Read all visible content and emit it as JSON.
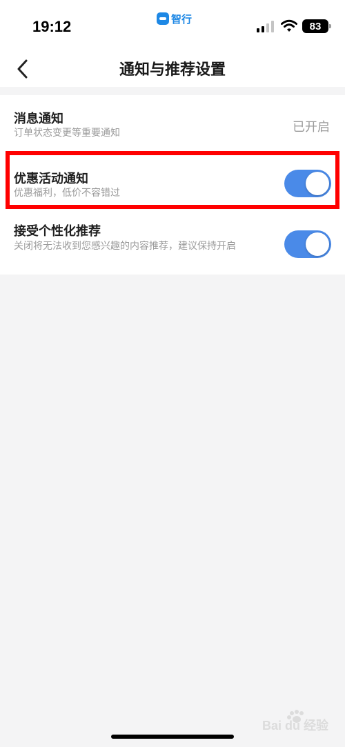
{
  "status_bar": {
    "time": "19:12",
    "app_badge": "智行",
    "battery": "83",
    "signal_bars": 4,
    "signal_bars_active": 2
  },
  "nav": {
    "back_icon": "chevron-left-icon",
    "title": "通知与推荐设置"
  },
  "settings": [
    {
      "title": "消息通知",
      "desc": "订单状态变更等重要通知",
      "value": "已开启"
    },
    {
      "title": "优惠活动通知",
      "desc": "优惠福利，低价不容错过",
      "toggle_on": true
    },
    {
      "title": "接受个性化推荐",
      "desc": "关闭将无法收到您感兴趣的内容推荐，建议保持开启",
      "toggle_on": true
    }
  ],
  "colors": {
    "accent": "#4a8ae8",
    "highlight": "#ff0000",
    "background": "#f4f4f5"
  },
  "watermark": {
    "label": "Bai du 经验"
  }
}
